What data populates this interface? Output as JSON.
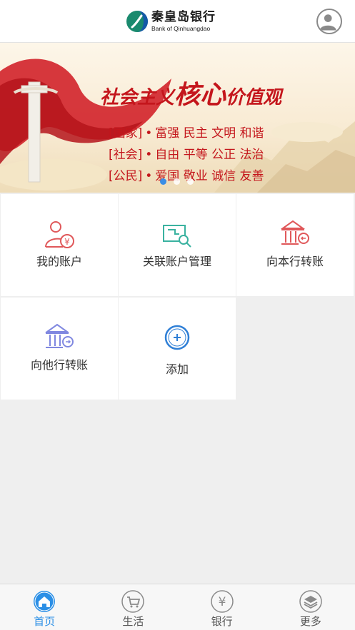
{
  "header": {
    "logo_cn": "秦皇岛银行",
    "logo_en": "Bank of Qinhuangdao"
  },
  "banner": {
    "title_prefix": "社会主义",
    "title_big": "核心",
    "title_suffix": "价值观",
    "rows": [
      {
        "tag": "[国家]",
        "values": "富强  民主  文明  和谐"
      },
      {
        "tag": "[社会]",
        "values": "自由  平等  公正  法治"
      },
      {
        "tag": "[公民]",
        "values": "爱国  敬业  诚信  友善"
      }
    ],
    "dot": "•",
    "active_slide": 1,
    "slide_count": 3
  },
  "tiles": [
    {
      "label": "我的账户",
      "icon": "user-yen-icon"
    },
    {
      "label": "关联账户管理",
      "icon": "linked-card-search-icon"
    },
    {
      "label": "向本行转账",
      "icon": "bank-transfer-icon"
    },
    {
      "label": "向他行转账",
      "icon": "other-bank-transfer-icon"
    },
    {
      "label": "添加",
      "icon": "add-circle-icon"
    }
  ],
  "tabs": [
    {
      "label": "首页",
      "icon": "home-icon",
      "active": true
    },
    {
      "label": "生活",
      "icon": "cart-icon",
      "active": false
    },
    {
      "label": "银行",
      "icon": "yen-icon",
      "active": false
    },
    {
      "label": "更多",
      "icon": "layers-icon",
      "active": false
    }
  ],
  "colors": {
    "accent": "#2b8fe6",
    "banner_red": "#c4161c",
    "icon_red": "#e0585a",
    "icon_green": "#3ab2a0",
    "icon_purple": "#8088e0",
    "icon_blue": "#2f7fd6"
  }
}
